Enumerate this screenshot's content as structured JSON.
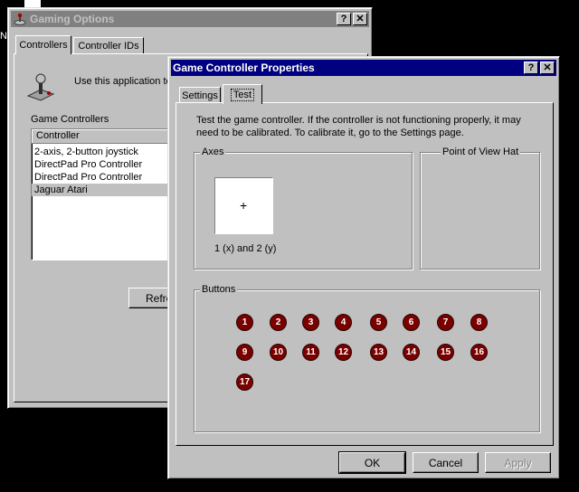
{
  "background_window": {
    "title": "Gaming Options",
    "tabs": [
      "Controllers",
      "Controller IDs"
    ],
    "description": "Use this application to",
    "group_label": "Game Controllers",
    "list_header": "Controller",
    "controllers": [
      "2-axis, 2-button joystick",
      "DirectPad Pro Controller",
      "DirectPad Pro Controller",
      "Jaguar Atari"
    ],
    "selected_index": 3,
    "refresh_label": "Refre"
  },
  "dialog": {
    "title": "Game Controller Properties",
    "tabs": [
      "Settings",
      "Test"
    ],
    "active_tab": "Test",
    "instructions": "Test the game controller.  If the controller is not functioning properly, it may need to be calibrated.  To calibrate it, go to the Settings page.",
    "axes_label": "Axes",
    "axes_crosshair": "+",
    "axes_caption": "1 (x) and 2 (y)",
    "pov_label": "Point of View Hat",
    "buttons_label": "Buttons",
    "buttons": [
      "1",
      "2",
      "3",
      "4",
      "5",
      "6",
      "7",
      "8",
      "9",
      "10",
      "11",
      "12",
      "13",
      "14",
      "15",
      "16",
      "17"
    ],
    "ok_label": "OK",
    "cancel_label": "Cancel",
    "apply_label": "Apply"
  },
  "titlebar_buttons": {
    "help": "?",
    "close": "✕"
  },
  "desktop_fragment": "N",
  "colors": {
    "desktop": "#000000",
    "face": "#c0c0c0",
    "active_title": "#000080",
    "inactive_title": "#808080",
    "button_indicator": "#7a0000"
  }
}
